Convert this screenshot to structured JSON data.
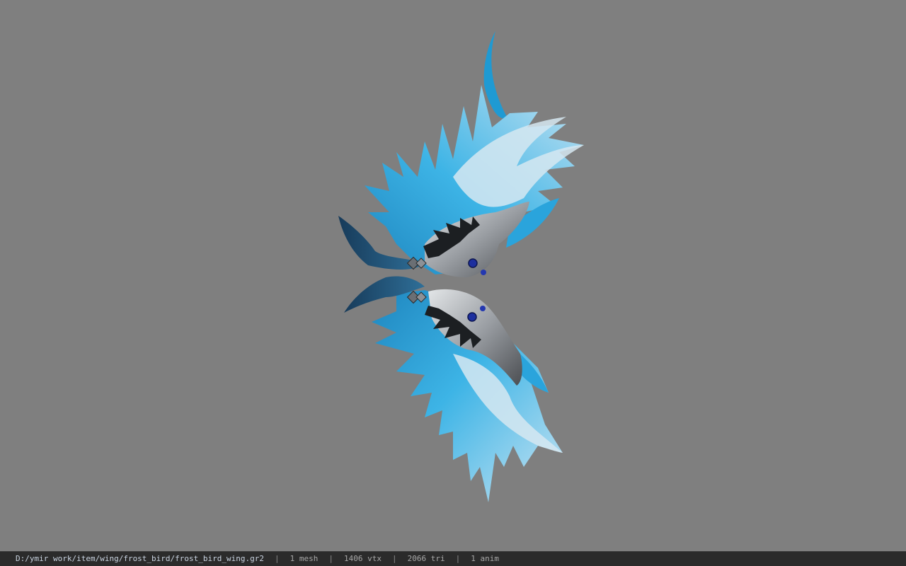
{
  "viewport": {
    "background": "#7f7f7f",
    "model_name": "frost_bird_wing"
  },
  "status_bar": {
    "file_path": "D:/ymir work/item/wing/frost_bird/frost_bird_wing.gr2",
    "separator": "|",
    "mesh_count": "1 mesh",
    "vertex_count": "1406 vtx",
    "triangle_count": "2066 tri",
    "anim_count": "1 anim"
  },
  "colors": {
    "feather_light": "#8fd2f2",
    "feather_mid": "#3fb2e4",
    "feather_dark": "#1b6fa0",
    "metal": "#a9adb1",
    "gem": "#1d2f9e",
    "status_bg": "#2b2b2b"
  }
}
